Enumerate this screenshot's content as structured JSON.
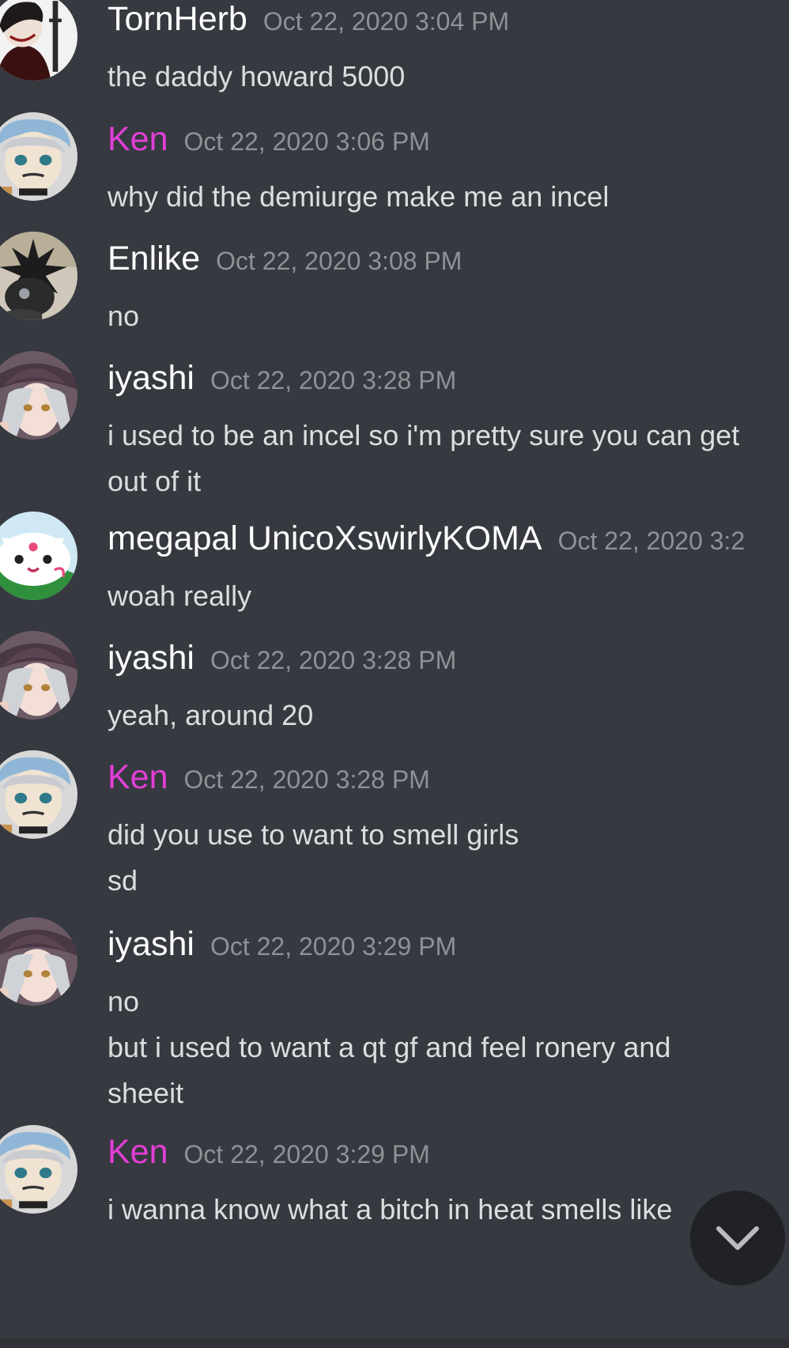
{
  "colors": {
    "background": "#36393f",
    "username_default": "#ffffff",
    "username_role": "#e23fd6",
    "timestamp": "#8e9297",
    "message_text": "#dcddde"
  },
  "messages": [
    {
      "username": "TornHerb",
      "name_color": "white",
      "timestamp": "Oct 22, 2020 3:04 PM",
      "avatar": "tornherb-avatar",
      "lines": [
        "the daddy howard 5000"
      ]
    },
    {
      "username": "Ken",
      "name_color": "pink",
      "timestamp": "Oct 22, 2020 3:06 PM",
      "avatar": "ken-avatar",
      "lines": [
        "why did the demiurge make me an incel"
      ]
    },
    {
      "username": "Enlike",
      "name_color": "white",
      "timestamp": "Oct 22, 2020 3:08 PM",
      "avatar": "enlike-avatar",
      "lines": [
        "no"
      ]
    },
    {
      "username": "iyashi",
      "name_color": "white",
      "timestamp": "Oct 22, 2020 3:28 PM",
      "avatar": "iyashi-avatar",
      "lines": [
        "i used to be an incel so i'm pretty sure you can get",
        "out of it"
      ]
    },
    {
      "username": "megapal UnicoXswirlyKOMA",
      "name_color": "white",
      "timestamp": "Oct 22, 2020 3:2",
      "avatar": "megapal-avatar",
      "lines": [
        "woah really"
      ]
    },
    {
      "username": "iyashi",
      "name_color": "white",
      "timestamp": "Oct 22, 2020 3:28 PM",
      "avatar": "iyashi-avatar",
      "lines": [
        "yeah, around 20"
      ]
    },
    {
      "username": "Ken",
      "name_color": "pink",
      "timestamp": "Oct 22, 2020 3:28 PM",
      "avatar": "ken-avatar",
      "lines": [
        "did you use to want to smell girls",
        "sd"
      ]
    },
    {
      "username": "iyashi",
      "name_color": "white",
      "timestamp": "Oct 22, 2020 3:29 PM",
      "avatar": "iyashi-avatar",
      "lines": [
        "no",
        "but i used to want a qt gf and feel ronery and",
        "sheeit"
      ]
    },
    {
      "username": "Ken",
      "name_color": "pink",
      "timestamp": "Oct 22, 2020 3:29 PM",
      "avatar": "ken-avatar",
      "lines": [
        "i wanna know what a bitch in heat smells like"
      ]
    }
  ],
  "scroll_button": {
    "icon": "chevron-down-icon"
  }
}
